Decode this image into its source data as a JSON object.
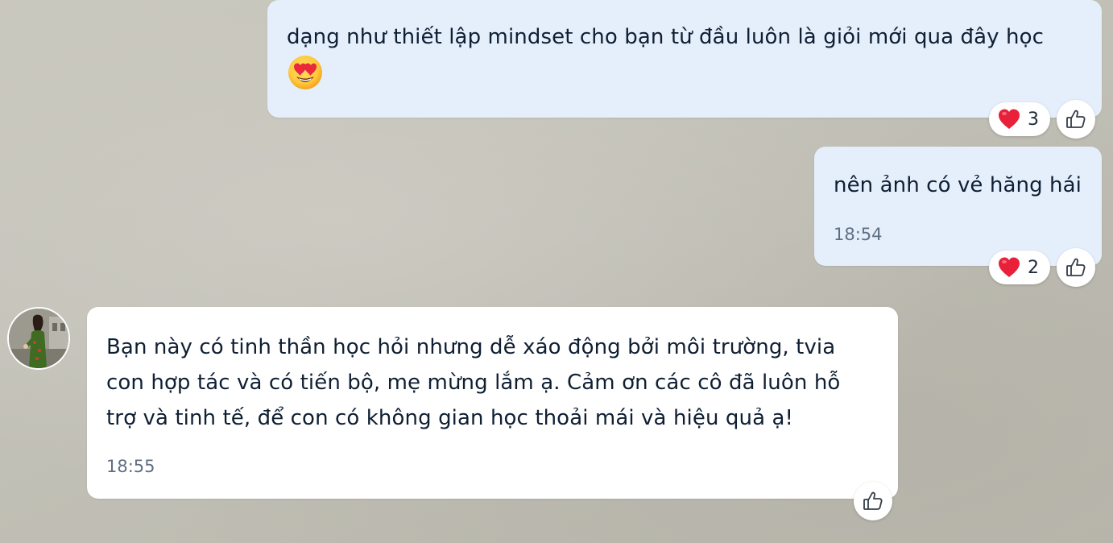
{
  "messages": [
    {
      "direction": "sent",
      "text": "dạng như thiết lập mindset cho bạn từ đầu luôn là giỏi mới qua đây học",
      "emoji": "heart-eyes-emoji",
      "reaction": {
        "icon": "heart-icon",
        "count": "3"
      }
    },
    {
      "direction": "sent",
      "text": "nên ảnh có vẻ hăng hái",
      "time": "18:54",
      "reaction": {
        "icon": "heart-icon",
        "count": "2"
      }
    },
    {
      "direction": "received",
      "lines": [
        "Bạn này có tinh thần học hỏi nhưng dễ xáo động bởi môi trường, tvia",
        "con hợp tác và có tiến bộ, mẹ mừng lắm ạ. Cảm ơn các cô đã luôn hỗ",
        "trợ và tinh tế, để con có không gian học thoải mái và hiệu quả ạ!"
      ],
      "time": "18:55"
    }
  ],
  "colors": {
    "sent_bubble": "#e5eefb",
    "received_bubble": "#ffffff",
    "heart": "#e8203a",
    "time_text": "#5f6f82"
  },
  "icons": {
    "like": "thumbs-up-icon",
    "reaction": "heart-icon",
    "emoji": "smiling-face-with-heart-eyes"
  }
}
